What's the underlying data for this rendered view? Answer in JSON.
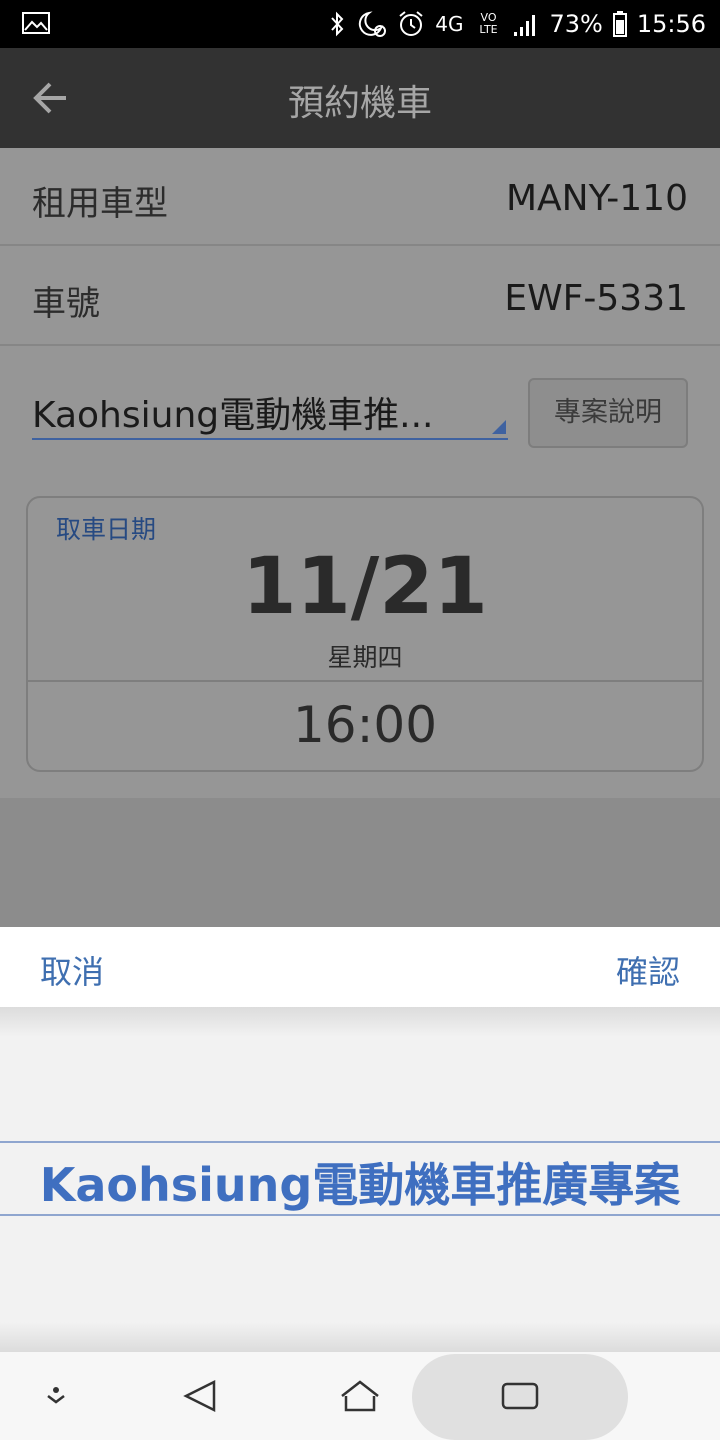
{
  "status_bar": {
    "network": "4G",
    "volte": "VO LTE",
    "battery": "73%",
    "time": "15:56",
    "icons": [
      "image-icon",
      "bluetooth-icon",
      "do-not-disturb-icon",
      "alarm-icon",
      "signal-icon",
      "battery-icon"
    ]
  },
  "app_bar": {
    "title": "預約機車",
    "back_icon": "arrow-left-icon"
  },
  "form": {
    "car_type_label": "租用車型",
    "car_type_value": "MANY-110",
    "plate_label": "車號",
    "plate_value": "EWF-5331",
    "plan_selected": "Kaohsiung電動機車推...",
    "plan_info_button": "專案說明",
    "pickup": {
      "label": "取車日期",
      "date": "11/21",
      "weekday": "星期四",
      "time": "16:00"
    }
  },
  "picker": {
    "cancel": "取消",
    "confirm": "確認",
    "selected_option": "Kaohsiung電動機車推廣專案"
  },
  "nav_bar": {
    "icons": [
      "dock-toggle-icon",
      "back-icon",
      "home-icon",
      "recents-icon"
    ]
  },
  "colors": {
    "accent": "#3f6fb0",
    "app_bar": "#323232",
    "dim_overlay": "#969696"
  }
}
